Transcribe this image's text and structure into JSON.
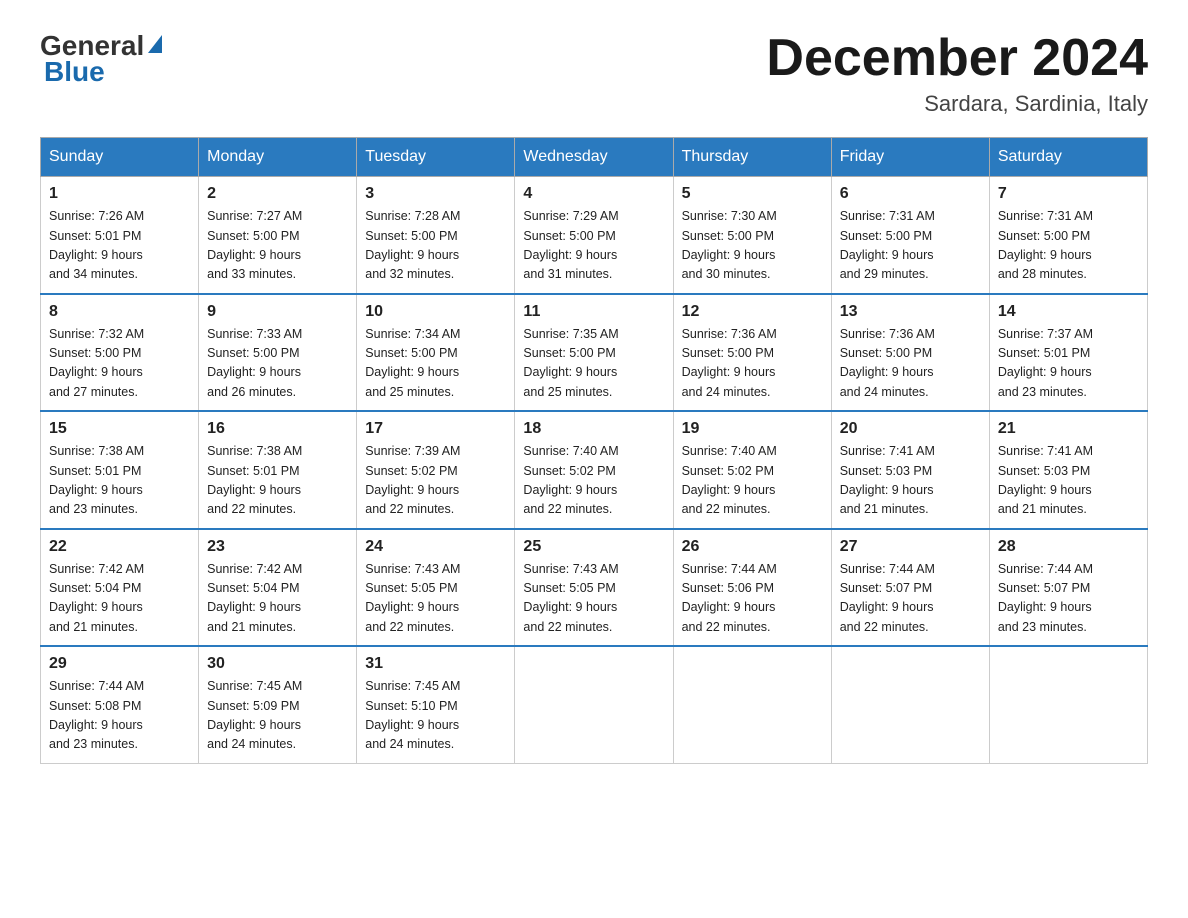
{
  "header": {
    "logo_general": "General",
    "logo_blue": "Blue",
    "title": "December 2024",
    "location": "Sardara, Sardinia, Italy"
  },
  "days_of_week": [
    "Sunday",
    "Monday",
    "Tuesday",
    "Wednesday",
    "Thursday",
    "Friday",
    "Saturday"
  ],
  "weeks": [
    [
      {
        "day": "1",
        "sunrise": "7:26 AM",
        "sunset": "5:01 PM",
        "daylight": "9 hours and 34 minutes."
      },
      {
        "day": "2",
        "sunrise": "7:27 AM",
        "sunset": "5:00 PM",
        "daylight": "9 hours and 33 minutes."
      },
      {
        "day": "3",
        "sunrise": "7:28 AM",
        "sunset": "5:00 PM",
        "daylight": "9 hours and 32 minutes."
      },
      {
        "day": "4",
        "sunrise": "7:29 AM",
        "sunset": "5:00 PM",
        "daylight": "9 hours and 31 minutes."
      },
      {
        "day": "5",
        "sunrise": "7:30 AM",
        "sunset": "5:00 PM",
        "daylight": "9 hours and 30 minutes."
      },
      {
        "day": "6",
        "sunrise": "7:31 AM",
        "sunset": "5:00 PM",
        "daylight": "9 hours and 29 minutes."
      },
      {
        "day": "7",
        "sunrise": "7:31 AM",
        "sunset": "5:00 PM",
        "daylight": "9 hours and 28 minutes."
      }
    ],
    [
      {
        "day": "8",
        "sunrise": "7:32 AM",
        "sunset": "5:00 PM",
        "daylight": "9 hours and 27 minutes."
      },
      {
        "day": "9",
        "sunrise": "7:33 AM",
        "sunset": "5:00 PM",
        "daylight": "9 hours and 26 minutes."
      },
      {
        "day": "10",
        "sunrise": "7:34 AM",
        "sunset": "5:00 PM",
        "daylight": "9 hours and 25 minutes."
      },
      {
        "day": "11",
        "sunrise": "7:35 AM",
        "sunset": "5:00 PM",
        "daylight": "9 hours and 25 minutes."
      },
      {
        "day": "12",
        "sunrise": "7:36 AM",
        "sunset": "5:00 PM",
        "daylight": "9 hours and 24 minutes."
      },
      {
        "day": "13",
        "sunrise": "7:36 AM",
        "sunset": "5:00 PM",
        "daylight": "9 hours and 24 minutes."
      },
      {
        "day": "14",
        "sunrise": "7:37 AM",
        "sunset": "5:01 PM",
        "daylight": "9 hours and 23 minutes."
      }
    ],
    [
      {
        "day": "15",
        "sunrise": "7:38 AM",
        "sunset": "5:01 PM",
        "daylight": "9 hours and 23 minutes."
      },
      {
        "day": "16",
        "sunrise": "7:38 AM",
        "sunset": "5:01 PM",
        "daylight": "9 hours and 22 minutes."
      },
      {
        "day": "17",
        "sunrise": "7:39 AM",
        "sunset": "5:02 PM",
        "daylight": "9 hours and 22 minutes."
      },
      {
        "day": "18",
        "sunrise": "7:40 AM",
        "sunset": "5:02 PM",
        "daylight": "9 hours and 22 minutes."
      },
      {
        "day": "19",
        "sunrise": "7:40 AM",
        "sunset": "5:02 PM",
        "daylight": "9 hours and 22 minutes."
      },
      {
        "day": "20",
        "sunrise": "7:41 AM",
        "sunset": "5:03 PM",
        "daylight": "9 hours and 21 minutes."
      },
      {
        "day": "21",
        "sunrise": "7:41 AM",
        "sunset": "5:03 PM",
        "daylight": "9 hours and 21 minutes."
      }
    ],
    [
      {
        "day": "22",
        "sunrise": "7:42 AM",
        "sunset": "5:04 PM",
        "daylight": "9 hours and 21 minutes."
      },
      {
        "day": "23",
        "sunrise": "7:42 AM",
        "sunset": "5:04 PM",
        "daylight": "9 hours and 21 minutes."
      },
      {
        "day": "24",
        "sunrise": "7:43 AM",
        "sunset": "5:05 PM",
        "daylight": "9 hours and 22 minutes."
      },
      {
        "day": "25",
        "sunrise": "7:43 AM",
        "sunset": "5:05 PM",
        "daylight": "9 hours and 22 minutes."
      },
      {
        "day": "26",
        "sunrise": "7:44 AM",
        "sunset": "5:06 PM",
        "daylight": "9 hours and 22 minutes."
      },
      {
        "day": "27",
        "sunrise": "7:44 AM",
        "sunset": "5:07 PM",
        "daylight": "9 hours and 22 minutes."
      },
      {
        "day": "28",
        "sunrise": "7:44 AM",
        "sunset": "5:07 PM",
        "daylight": "9 hours and 23 minutes."
      }
    ],
    [
      {
        "day": "29",
        "sunrise": "7:44 AM",
        "sunset": "5:08 PM",
        "daylight": "9 hours and 23 minutes."
      },
      {
        "day": "30",
        "sunrise": "7:45 AM",
        "sunset": "5:09 PM",
        "daylight": "9 hours and 24 minutes."
      },
      {
        "day": "31",
        "sunrise": "7:45 AM",
        "sunset": "5:10 PM",
        "daylight": "9 hours and 24 minutes."
      },
      null,
      null,
      null,
      null
    ]
  ],
  "labels": {
    "sunrise_prefix": "Sunrise: ",
    "sunset_prefix": "Sunset: ",
    "daylight_prefix": "Daylight: "
  }
}
